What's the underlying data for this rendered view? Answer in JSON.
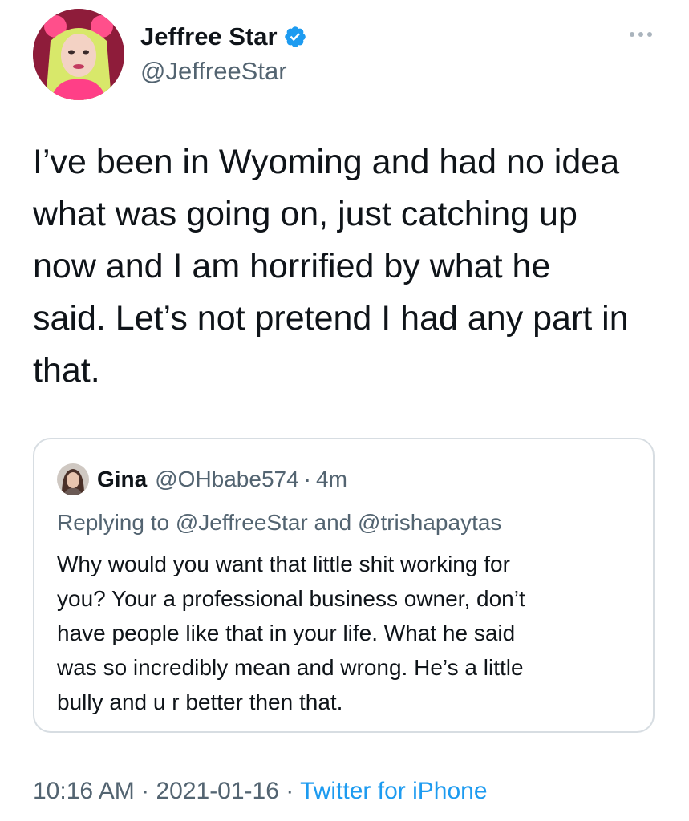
{
  "author": {
    "name": "Jeffree Star",
    "handle": "@JeffreeStar",
    "verified": true
  },
  "tweet": {
    "text_lines": [
      "I’ve been in Wyoming and had no idea",
      "what was going on, just catching up",
      "now and I am horrified by what he",
      "said. Let’s not pretend I had any part in",
      "that."
    ]
  },
  "quoted_tweet": {
    "name": "Gina",
    "handle": "@OHbabe574",
    "separator": "·",
    "time": "4m",
    "replying_prefix": "Replying to",
    "replying_to_1": "@JeffreeStar",
    "replying_and": "and",
    "replying_to_2": "@trishapaytas",
    "text_lines": [
      "Why would you want that little shit working for",
      "you? Your a professional business owner, don’t",
      "have people like that in your life. What he said",
      "was so incredibly mean and wrong. He’s a little",
      "bully and u r better then that."
    ]
  },
  "meta": {
    "time": "10:16 AM",
    "separator": "·",
    "date": "2021-01-16",
    "source": "Twitter for iPhone"
  },
  "colors": {
    "text": "#0f1419",
    "secondary": "#536471",
    "link": "#1d9bf0",
    "border": "#d7dde2",
    "verified": "#1d9bf0"
  },
  "icons": {
    "verified": "verified-badge-icon",
    "more": "more-options-icon"
  }
}
